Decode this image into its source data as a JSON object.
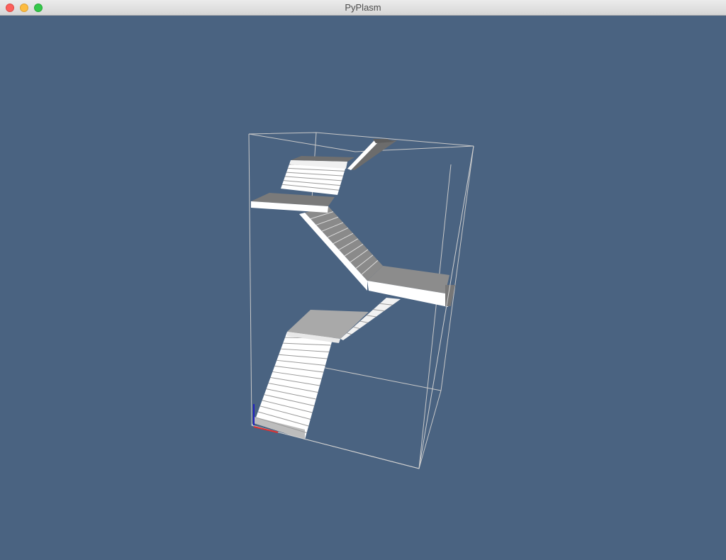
{
  "window": {
    "title": "PyPlasm",
    "buttons": [
      "close",
      "minimize",
      "zoom"
    ]
  },
  "viewport": {
    "background_color": "#4a6381",
    "model": "staircase",
    "bounding_box_color": "#c8c8c8",
    "step_color": "#ffffff",
    "axis_colors": {
      "x": "#e03030",
      "z": "#2020c0"
    }
  }
}
